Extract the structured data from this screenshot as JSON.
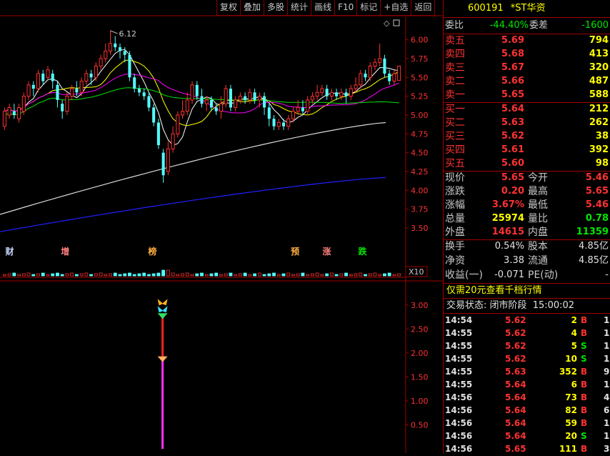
{
  "toolbar": [
    "复权",
    "叠加",
    "多股",
    "统计",
    "画线",
    "F10",
    "标记",
    "+自选",
    "返回"
  ],
  "stock": {
    "code": "600191",
    "name": "*ST华资"
  },
  "order_ratio": {
    "label1": "委比",
    "value1": "-44.40%",
    "label2": "委差",
    "value2": "-1600"
  },
  "asks": [
    {
      "label": "卖五",
      "price": "5.69",
      "vol": "794"
    },
    {
      "label": "卖四",
      "price": "5.68",
      "vol": "413"
    },
    {
      "label": "卖三",
      "price": "5.67",
      "vol": "320"
    },
    {
      "label": "卖二",
      "price": "5.66",
      "vol": "487"
    },
    {
      "label": "卖一",
      "price": "5.65",
      "vol": "588"
    }
  ],
  "bids": [
    {
      "label": "买一",
      "price": "5.64",
      "vol": "212"
    },
    {
      "label": "买二",
      "price": "5.63",
      "vol": "262"
    },
    {
      "label": "买三",
      "price": "5.62",
      "vol": "38"
    },
    {
      "label": "买四",
      "price": "5.61",
      "vol": "392"
    },
    {
      "label": "买五",
      "price": "5.60",
      "vol": "98"
    }
  ],
  "quote": [
    {
      "l1": "现价",
      "v1": "5.65",
      "c1": "red",
      "l2": "今开",
      "v2": "5.46",
      "c2": "red"
    },
    {
      "l1": "涨跌",
      "v1": "0.20",
      "c1": "red",
      "l2": "最高",
      "v2": "5.65",
      "c2": "red"
    },
    {
      "l1": "涨幅",
      "v1": "3.67%",
      "c1": "red",
      "l2": "最低",
      "v2": "5.46",
      "c2": "red"
    },
    {
      "l1": "总量",
      "v1": "25974",
      "c1": "yel",
      "l2": "量比",
      "v2": "0.78",
      "c2": "grn"
    },
    {
      "l1": "外盘",
      "v1": "14615",
      "c1": "red",
      "l2": "内盘",
      "v2": "11359",
      "c2": "grn"
    }
  ],
  "fundamentals": [
    {
      "l1": "换手",
      "v1": "0.54%",
      "l2": "股本",
      "v2": "4.85亿"
    },
    {
      "l1": "净资",
      "v1": "3.38",
      "l2": "流通",
      "v2": "4.85亿"
    },
    {
      "l1": "收益(一)",
      "v1": "-0.071",
      "l2": "PE(动)",
      "v2": "-"
    }
  ],
  "promo": "仅需20元查看千档行情",
  "trade_status": {
    "label": "交易状态:",
    "value": "闭市阶段",
    "time": "15:00:02"
  },
  "ticks": [
    {
      "time": "14:54",
      "price": "5.62",
      "vol": "2",
      "bs": "B",
      "n": "1"
    },
    {
      "time": "14:55",
      "price": "5.62",
      "vol": "4",
      "bs": "B",
      "n": "1"
    },
    {
      "time": "14:55",
      "price": "5.62",
      "vol": "5",
      "bs": "S",
      "n": "1"
    },
    {
      "time": "14:55",
      "price": "5.62",
      "vol": "10",
      "bs": "S",
      "n": "1"
    },
    {
      "time": "14:55",
      "price": "5.63",
      "vol": "352",
      "bs": "B",
      "n": "9"
    },
    {
      "time": "14:55",
      "price": "5.64",
      "vol": "6",
      "bs": "B",
      "n": "1"
    },
    {
      "time": "14:56",
      "price": "5.64",
      "vol": "73",
      "bs": "B",
      "n": "4"
    },
    {
      "time": "14:56",
      "price": "5.64",
      "vol": "82",
      "bs": "B",
      "n": "6"
    },
    {
      "time": "14:56",
      "price": "5.64",
      "vol": "59",
      "bs": "B",
      "n": "1"
    },
    {
      "time": "14:56",
      "price": "5.64",
      "vol": "20",
      "bs": "S",
      "n": "1"
    },
    {
      "time": "14:56",
      "price": "5.65",
      "vol": "111",
      "bs": "B",
      "n": "3"
    }
  ],
  "chart_data": {
    "type": "candlestick",
    "price_axis": {
      "ticks": [
        "6.00",
        "5.75",
        "5.50",
        "5.25",
        "5.00",
        "4.75",
        "4.50",
        "4.25",
        "4.00",
        "3.75",
        "3.50"
      ],
      "range": [
        3.3,
        6.3
      ]
    },
    "high_annotation": "6.12",
    "candles": [
      [
        4.85,
        5.05,
        4.8,
        5.1
      ],
      [
        5.0,
        5.1,
        4.95,
        5.15
      ],
      [
        5.05,
        5.0,
        4.95,
        5.15
      ],
      [
        4.95,
        5.1,
        4.9,
        5.15
      ],
      [
        5.05,
        5.25,
        5.0,
        5.3
      ],
      [
        5.25,
        5.4,
        5.2,
        5.45
      ],
      [
        5.4,
        5.35,
        5.25,
        5.45
      ],
      [
        5.35,
        5.55,
        5.3,
        5.6
      ],
      [
        5.55,
        5.45,
        5.4,
        5.6
      ],
      [
        5.5,
        5.6,
        5.45,
        5.65
      ],
      [
        5.55,
        5.45,
        5.35,
        5.6
      ],
      [
        5.4,
        5.2,
        5.1,
        5.45
      ],
      [
        5.15,
        5.05,
        4.95,
        5.2
      ],
      [
        5.05,
        5.25,
        5.0,
        5.3
      ],
      [
        5.25,
        5.35,
        5.2,
        5.4
      ],
      [
        5.35,
        5.3,
        5.25,
        5.45
      ],
      [
        5.3,
        5.45,
        5.25,
        5.5
      ],
      [
        5.45,
        5.55,
        5.4,
        5.6
      ],
      [
        5.55,
        5.5,
        5.4,
        5.6
      ],
      [
        5.5,
        5.65,
        5.45,
        5.7
      ],
      [
        5.65,
        5.75,
        5.6,
        5.8
      ],
      [
        5.75,
        5.85,
        5.7,
        5.95
      ],
      [
        5.85,
        5.95,
        5.8,
        6.12
      ],
      [
        5.95,
        5.9,
        5.85,
        6.05
      ],
      [
        5.9,
        5.85,
        5.75,
        5.95
      ],
      [
        5.85,
        5.8,
        5.7,
        5.9
      ],
      [
        5.8,
        5.5,
        5.45,
        5.85
      ],
      [
        5.5,
        5.35,
        5.3,
        5.55
      ],
      [
        5.35,
        5.3,
        5.25,
        5.4
      ],
      [
        5.3,
        5.25,
        5.2,
        5.35
      ],
      [
        5.25,
        5.1,
        5.05,
        5.3
      ],
      [
        5.1,
        4.9,
        4.85,
        5.15
      ],
      [
        4.9,
        4.6,
        4.55,
        4.95
      ],
      [
        4.5,
        4.2,
        4.1,
        4.55
      ],
      [
        4.25,
        4.55,
        4.2,
        4.65
      ],
      [
        4.55,
        4.75,
        4.5,
        4.85
      ],
      [
        4.75,
        5.0,
        4.7,
        5.05
      ],
      [
        5.0,
        5.05,
        4.95,
        5.2
      ],
      [
        5.05,
        5.2,
        5.0,
        5.3
      ],
      [
        5.2,
        5.4,
        5.15,
        5.45
      ],
      [
        5.4,
        5.25,
        5.2,
        5.45
      ],
      [
        5.25,
        5.15,
        5.1,
        5.35
      ],
      [
        5.15,
        5.2,
        5.05,
        5.25
      ],
      [
        5.2,
        5.1,
        5.05,
        5.25
      ],
      [
        5.1,
        5.05,
        5.0,
        5.15
      ],
      [
        5.05,
        5.15,
        4.95,
        5.25
      ],
      [
        5.15,
        5.35,
        5.1,
        5.4
      ],
      [
        5.35,
        5.1,
        5.05,
        5.4
      ],
      [
        5.1,
        5.2,
        5.05,
        5.25
      ],
      [
        5.2,
        5.25,
        5.15,
        5.3
      ],
      [
        5.25,
        5.2,
        5.15,
        5.3
      ],
      [
        5.2,
        5.3,
        5.15,
        5.35
      ],
      [
        5.3,
        5.2,
        5.15,
        5.35
      ],
      [
        5.2,
        5.25,
        5.1,
        5.3
      ],
      [
        5.25,
        5.1,
        5.0,
        5.3
      ],
      [
        5.1,
        4.95,
        4.85,
        5.15
      ],
      [
        4.95,
        4.85,
        4.8,
        5.0
      ],
      [
        4.85,
        4.9,
        4.8,
        4.95
      ],
      [
        4.9,
        4.85,
        4.8,
        4.95
      ],
      [
        4.85,
        4.95,
        4.8,
        5.0
      ],
      [
        4.95,
        5.05,
        4.9,
        5.1
      ],
      [
        5.05,
        5.1,
        5.0,
        5.2
      ],
      [
        5.1,
        5.05,
        5.0,
        5.2
      ],
      [
        5.05,
        5.2,
        5.0,
        5.25
      ],
      [
        5.2,
        5.25,
        5.15,
        5.3
      ],
      [
        5.25,
        5.3,
        5.2,
        5.4
      ],
      [
        5.3,
        5.35,
        5.25,
        5.4
      ],
      [
        5.35,
        5.25,
        5.2,
        5.4
      ],
      [
        5.25,
        5.3,
        5.2,
        5.35
      ],
      [
        5.3,
        5.25,
        5.2,
        5.35
      ],
      [
        5.25,
        5.3,
        5.2,
        5.35
      ],
      [
        5.3,
        5.25,
        5.15,
        5.35
      ],
      [
        5.25,
        5.35,
        5.2,
        5.4
      ],
      [
        5.35,
        5.4,
        5.3,
        5.5
      ],
      [
        5.4,
        5.55,
        5.35,
        5.6
      ],
      [
        5.55,
        5.5,
        5.45,
        5.6
      ],
      [
        5.5,
        5.65,
        5.45,
        5.7
      ],
      [
        5.65,
        5.7,
        5.6,
        5.75
      ],
      [
        5.7,
        5.75,
        5.65,
        5.95
      ],
      [
        5.75,
        5.55,
        5.5,
        5.8
      ],
      [
        5.55,
        5.45,
        5.4,
        5.6
      ],
      [
        5.45,
        5.55,
        5.4,
        5.6
      ],
      [
        5.46,
        5.65,
        5.46,
        5.65
      ]
    ],
    "ma_series": [
      {
        "color": "#ffffff",
        "period": 5
      },
      {
        "color": "#ffff00",
        "period": 10
      },
      {
        "color": "#ff00ff",
        "period": 20
      },
      {
        "color": "#00e600",
        "period": 60
      }
    ],
    "slow_lines": [
      {
        "color": "#d8d8d8",
        "from": 3.68,
        "to": 4.9
      },
      {
        "color": "#2020ff",
        "from": 3.45,
        "to": 4.17
      }
    ],
    "markers": [
      {
        "text": "财",
        "color": "#c8d8ff",
        "pos": 0.01
      },
      {
        "text": "增",
        "color": "#ff8080",
        "pos": 0.15
      },
      {
        "text": "榜",
        "color": "#ffb040",
        "pos": 0.37
      },
      {
        "text": "预",
        "color": "#ffb040",
        "pos": 0.73
      },
      {
        "text": "涨",
        "color": "#ff8080",
        "pos": 0.81
      },
      {
        "text": "跌",
        "color": "#00e600",
        "pos": 0.9
      }
    ],
    "vol_scale": "X10",
    "indicator_axis": {
      "ticks": [
        "3.00",
        "2.50",
        "2.00",
        "1.50",
        "1.00",
        "0.50"
      ],
      "range": [
        0,
        3.4
      ]
    },
    "indicator": {
      "bar_index": 33,
      "value_top": 2.8,
      "value_mid": 1.9,
      "value_bottom": 0
    }
  }
}
